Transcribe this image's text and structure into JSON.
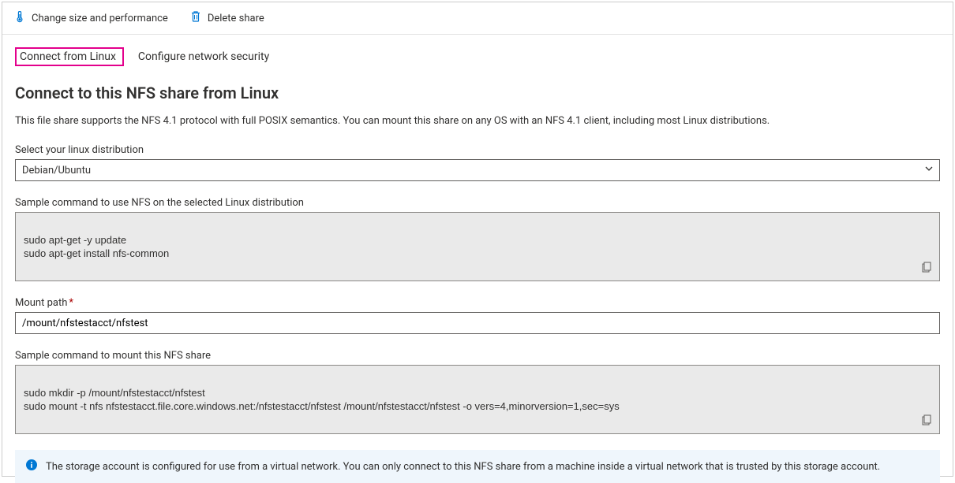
{
  "toolbar": {
    "change_size_label": "Change size and performance",
    "delete_label": "Delete share"
  },
  "tabs": {
    "connect_linux": "Connect from Linux",
    "configure_network": "Configure network security"
  },
  "page": {
    "title": "Connect to this NFS share from Linux",
    "description": "This file share supports the NFS 4.1 protocol with full POSIX semantics. You can mount this share on any OS with an NFS 4.1 client, including most Linux distributions."
  },
  "distro": {
    "label": "Select your linux distribution",
    "value": "Debian/Ubuntu"
  },
  "install_cmd": {
    "label": "Sample command to use NFS on the selected Linux distribution",
    "code": "sudo apt-get -y update\nsudo apt-get install nfs-common"
  },
  "mount_path": {
    "label": "Mount path",
    "value": "/mount/nfstestacct/nfstest"
  },
  "mount_cmd": {
    "label": "Sample command to mount this NFS share",
    "code": "sudo mkdir -p /mount/nfstestacct/nfstest\nsudo mount -t nfs nfstestacct.file.core.windows.net:/nfstestacct/nfstest /mount/nfstestacct/nfstest -o vers=4,minorversion=1,sec=sys"
  },
  "info": {
    "message": "The storage account is configured for use from a virtual network. You can only connect to this NFS share from a machine inside a virtual network that is trusted by this storage account."
  }
}
